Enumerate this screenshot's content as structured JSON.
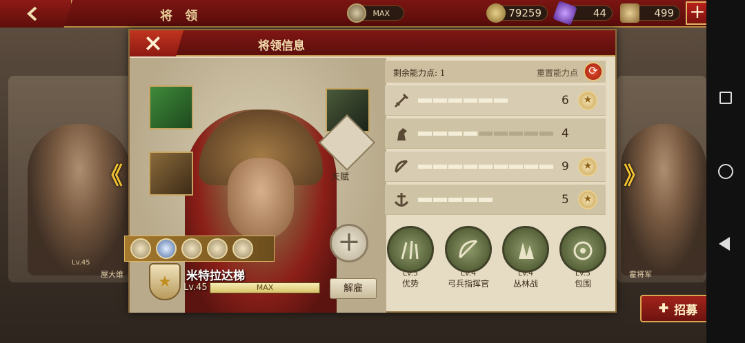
{
  "topbar": {
    "title": "将 领",
    "building_level": "MAX",
    "coins": "79259",
    "gems": "44",
    "honor": "499"
  },
  "background": {
    "left_general_name": "屋大维",
    "left_general_level": "Lv.45",
    "right_general_name": "霍将军",
    "recruit_label": "招募"
  },
  "dialog": {
    "title": "将领信息",
    "talent_label": "天赋",
    "general_name": "米特拉达梯",
    "general_level": "Lv.45",
    "exp_label": "MAX",
    "dismiss_label": "解雇",
    "points_label": "剩余能力点: 1",
    "reset_label": "重置能力点",
    "stats": [
      {
        "icon": "sword-icon",
        "value": "6",
        "filled": 6
      },
      {
        "icon": "horse-icon",
        "value": "4",
        "filled": 4
      },
      {
        "icon": "bow-icon",
        "value": "9",
        "filled": 9
      },
      {
        "icon": "anchor-icon",
        "value": "5",
        "filled": 5
      }
    ],
    "skills": [
      {
        "level": "Lv.5",
        "name": "优势"
      },
      {
        "level": "Lv.4",
        "name": "弓兵指挥官"
      },
      {
        "level": "Lv.4",
        "name": "丛林战"
      },
      {
        "level": "Lv.5",
        "name": "包围"
      }
    ]
  },
  "colors": {
    "accent_red": "#7f1714",
    "gold": "#c49a52",
    "panel": "#e6dcc4"
  }
}
